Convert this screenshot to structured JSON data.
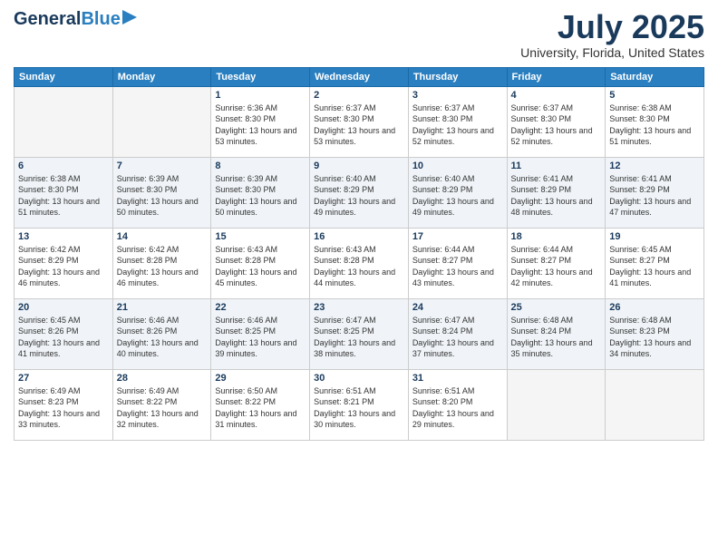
{
  "logo": {
    "line1": "General",
    "line2": "Blue"
  },
  "title": "July 2025",
  "subtitle": "University, Florida, United States",
  "weekdays": [
    "Sunday",
    "Monday",
    "Tuesday",
    "Wednesday",
    "Thursday",
    "Friday",
    "Saturday"
  ],
  "weeks": [
    [
      {
        "day": "",
        "sunrise": "",
        "sunset": "",
        "daylight": "",
        "empty": true
      },
      {
        "day": "",
        "sunrise": "",
        "sunset": "",
        "daylight": "",
        "empty": true
      },
      {
        "day": "1",
        "sunrise": "Sunrise: 6:36 AM",
        "sunset": "Sunset: 8:30 PM",
        "daylight": "Daylight: 13 hours and 53 minutes.",
        "empty": false
      },
      {
        "day": "2",
        "sunrise": "Sunrise: 6:37 AM",
        "sunset": "Sunset: 8:30 PM",
        "daylight": "Daylight: 13 hours and 53 minutes.",
        "empty": false
      },
      {
        "day": "3",
        "sunrise": "Sunrise: 6:37 AM",
        "sunset": "Sunset: 8:30 PM",
        "daylight": "Daylight: 13 hours and 52 minutes.",
        "empty": false
      },
      {
        "day": "4",
        "sunrise": "Sunrise: 6:37 AM",
        "sunset": "Sunset: 8:30 PM",
        "daylight": "Daylight: 13 hours and 52 minutes.",
        "empty": false
      },
      {
        "day": "5",
        "sunrise": "Sunrise: 6:38 AM",
        "sunset": "Sunset: 8:30 PM",
        "daylight": "Daylight: 13 hours and 51 minutes.",
        "empty": false
      }
    ],
    [
      {
        "day": "6",
        "sunrise": "Sunrise: 6:38 AM",
        "sunset": "Sunset: 8:30 PM",
        "daylight": "Daylight: 13 hours and 51 minutes.",
        "empty": false
      },
      {
        "day": "7",
        "sunrise": "Sunrise: 6:39 AM",
        "sunset": "Sunset: 8:30 PM",
        "daylight": "Daylight: 13 hours and 50 minutes.",
        "empty": false
      },
      {
        "day": "8",
        "sunrise": "Sunrise: 6:39 AM",
        "sunset": "Sunset: 8:30 PM",
        "daylight": "Daylight: 13 hours and 50 minutes.",
        "empty": false
      },
      {
        "day": "9",
        "sunrise": "Sunrise: 6:40 AM",
        "sunset": "Sunset: 8:29 PM",
        "daylight": "Daylight: 13 hours and 49 minutes.",
        "empty": false
      },
      {
        "day": "10",
        "sunrise": "Sunrise: 6:40 AM",
        "sunset": "Sunset: 8:29 PM",
        "daylight": "Daylight: 13 hours and 49 minutes.",
        "empty": false
      },
      {
        "day": "11",
        "sunrise": "Sunrise: 6:41 AM",
        "sunset": "Sunset: 8:29 PM",
        "daylight": "Daylight: 13 hours and 48 minutes.",
        "empty": false
      },
      {
        "day": "12",
        "sunrise": "Sunrise: 6:41 AM",
        "sunset": "Sunset: 8:29 PM",
        "daylight": "Daylight: 13 hours and 47 minutes.",
        "empty": false
      }
    ],
    [
      {
        "day": "13",
        "sunrise": "Sunrise: 6:42 AM",
        "sunset": "Sunset: 8:29 PM",
        "daylight": "Daylight: 13 hours and 46 minutes.",
        "empty": false
      },
      {
        "day": "14",
        "sunrise": "Sunrise: 6:42 AM",
        "sunset": "Sunset: 8:28 PM",
        "daylight": "Daylight: 13 hours and 46 minutes.",
        "empty": false
      },
      {
        "day": "15",
        "sunrise": "Sunrise: 6:43 AM",
        "sunset": "Sunset: 8:28 PM",
        "daylight": "Daylight: 13 hours and 45 minutes.",
        "empty": false
      },
      {
        "day": "16",
        "sunrise": "Sunrise: 6:43 AM",
        "sunset": "Sunset: 8:28 PM",
        "daylight": "Daylight: 13 hours and 44 minutes.",
        "empty": false
      },
      {
        "day": "17",
        "sunrise": "Sunrise: 6:44 AM",
        "sunset": "Sunset: 8:27 PM",
        "daylight": "Daylight: 13 hours and 43 minutes.",
        "empty": false
      },
      {
        "day": "18",
        "sunrise": "Sunrise: 6:44 AM",
        "sunset": "Sunset: 8:27 PM",
        "daylight": "Daylight: 13 hours and 42 minutes.",
        "empty": false
      },
      {
        "day": "19",
        "sunrise": "Sunrise: 6:45 AM",
        "sunset": "Sunset: 8:27 PM",
        "daylight": "Daylight: 13 hours and 41 minutes.",
        "empty": false
      }
    ],
    [
      {
        "day": "20",
        "sunrise": "Sunrise: 6:45 AM",
        "sunset": "Sunset: 8:26 PM",
        "daylight": "Daylight: 13 hours and 41 minutes.",
        "empty": false
      },
      {
        "day": "21",
        "sunrise": "Sunrise: 6:46 AM",
        "sunset": "Sunset: 8:26 PM",
        "daylight": "Daylight: 13 hours and 40 minutes.",
        "empty": false
      },
      {
        "day": "22",
        "sunrise": "Sunrise: 6:46 AM",
        "sunset": "Sunset: 8:25 PM",
        "daylight": "Daylight: 13 hours and 39 minutes.",
        "empty": false
      },
      {
        "day": "23",
        "sunrise": "Sunrise: 6:47 AM",
        "sunset": "Sunset: 8:25 PM",
        "daylight": "Daylight: 13 hours and 38 minutes.",
        "empty": false
      },
      {
        "day": "24",
        "sunrise": "Sunrise: 6:47 AM",
        "sunset": "Sunset: 8:24 PM",
        "daylight": "Daylight: 13 hours and 37 minutes.",
        "empty": false
      },
      {
        "day": "25",
        "sunrise": "Sunrise: 6:48 AM",
        "sunset": "Sunset: 8:24 PM",
        "daylight": "Daylight: 13 hours and 35 minutes.",
        "empty": false
      },
      {
        "day": "26",
        "sunrise": "Sunrise: 6:48 AM",
        "sunset": "Sunset: 8:23 PM",
        "daylight": "Daylight: 13 hours and 34 minutes.",
        "empty": false
      }
    ],
    [
      {
        "day": "27",
        "sunrise": "Sunrise: 6:49 AM",
        "sunset": "Sunset: 8:23 PM",
        "daylight": "Daylight: 13 hours and 33 minutes.",
        "empty": false
      },
      {
        "day": "28",
        "sunrise": "Sunrise: 6:49 AM",
        "sunset": "Sunset: 8:22 PM",
        "daylight": "Daylight: 13 hours and 32 minutes.",
        "empty": false
      },
      {
        "day": "29",
        "sunrise": "Sunrise: 6:50 AM",
        "sunset": "Sunset: 8:22 PM",
        "daylight": "Daylight: 13 hours and 31 minutes.",
        "empty": false
      },
      {
        "day": "30",
        "sunrise": "Sunrise: 6:51 AM",
        "sunset": "Sunset: 8:21 PM",
        "daylight": "Daylight: 13 hours and 30 minutes.",
        "empty": false
      },
      {
        "day": "31",
        "sunrise": "Sunrise: 6:51 AM",
        "sunset": "Sunset: 8:20 PM",
        "daylight": "Daylight: 13 hours and 29 minutes.",
        "empty": false
      },
      {
        "day": "",
        "sunrise": "",
        "sunset": "",
        "daylight": "",
        "empty": true
      },
      {
        "day": "",
        "sunrise": "",
        "sunset": "",
        "daylight": "",
        "empty": true
      }
    ]
  ]
}
